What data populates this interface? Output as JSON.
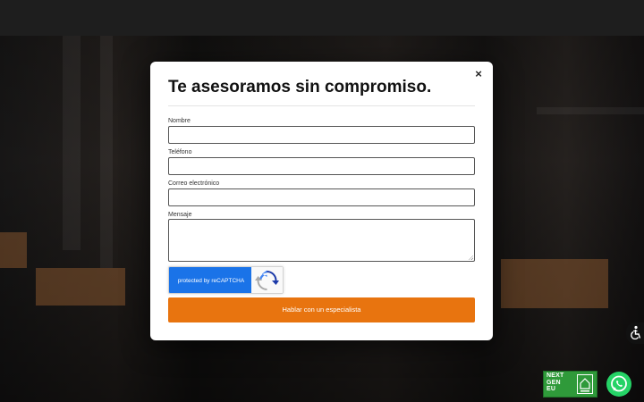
{
  "modal": {
    "title": "Te asesoramos sin compromiso.",
    "close_icon": "×",
    "fields": {
      "name_label": "Nombre",
      "phone_label": "Teléfono",
      "email_label": "Correo electrónico",
      "message_label": "Mensaje"
    },
    "recaptcha_text": "protected by reCAPTCHA",
    "submit_label": "Hablar con un especialista"
  },
  "badge": {
    "line1": "NEXT",
    "line2": "GEN",
    "line3": "EU"
  },
  "colors": {
    "accent": "#e8740f",
    "recaptcha_blue": "#1a73e8",
    "whatsapp_green": "#25d366",
    "badge_green": "#2f9a3a"
  },
  "icons": {
    "close": "close-icon",
    "accessibility": "accessibility-icon",
    "whatsapp": "whatsapp-icon",
    "recaptcha": "recaptcha-icon"
  }
}
